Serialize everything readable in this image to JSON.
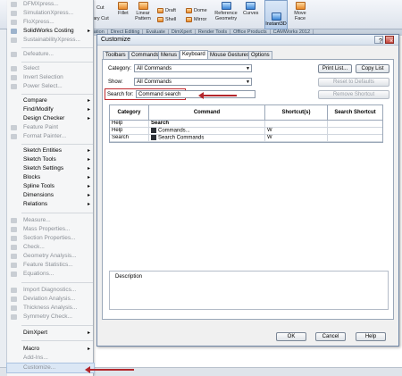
{
  "ribbon": {
    "tools": [
      {
        "label": "Fillet"
      },
      {
        "label": "Linear Pattern"
      },
      {
        "label": "Draft"
      },
      {
        "label": "Shell"
      },
      {
        "label": "Dome"
      },
      {
        "label": "Mirror"
      },
      {
        "label": "Reference Geometry"
      },
      {
        "label": "Curves"
      },
      {
        "label": "Move Face"
      }
    ],
    "instant3d": "Instant3D",
    "cut_label": "Cut",
    "ary_cut_label": "ary Cut",
    "tabs": [
      "ration",
      "Direct Editing",
      "Evaluate",
      "DimXpert",
      "Render Tools",
      "Office Products",
      "CAMWorks 2012"
    ]
  },
  "menu": {
    "items": [
      {
        "label": "DFMXpress...",
        "enabled": false
      },
      {
        "label": "SimulationXpress...",
        "enabled": false
      },
      {
        "label": "FloXpress...",
        "enabled": false
      },
      {
        "label": "SolidWorks Costing",
        "enabled": true,
        "submenu": true
      },
      {
        "label": "SustainabilityXpress...",
        "enabled": false
      },
      {
        "label": "Defeature...",
        "enabled": false
      },
      {
        "label": "Select",
        "enabled": false
      },
      {
        "label": "Invert Selection",
        "enabled": false
      },
      {
        "label": "Power Select...",
        "enabled": false
      },
      {
        "label": "Compare",
        "enabled": true,
        "submenu": true
      },
      {
        "label": "Find/Modify",
        "enabled": true,
        "submenu": true
      },
      {
        "label": "Design Checker",
        "enabled": true,
        "submenu": true
      },
      {
        "label": "Feature Paint",
        "enabled": false
      },
      {
        "label": "Format Painter...",
        "enabled": false
      },
      {
        "label": "Sketch Entities",
        "enabled": true,
        "submenu": true
      },
      {
        "label": "Sketch Tools",
        "enabled": true,
        "submenu": true
      },
      {
        "label": "Sketch Settings",
        "enabled": true,
        "submenu": true
      },
      {
        "label": "Blocks",
        "enabled": true,
        "submenu": true
      },
      {
        "label": "Spline Tools",
        "enabled": true,
        "submenu": true
      },
      {
        "label": "Dimensions",
        "enabled": true,
        "submenu": true
      },
      {
        "label": "Relations",
        "enabled": true,
        "submenu": true
      },
      {
        "label": "Measure...",
        "enabled": false
      },
      {
        "label": "Mass Properties...",
        "enabled": false
      },
      {
        "label": "Section Properties...",
        "enabled": false
      },
      {
        "label": "Check...",
        "enabled": false
      },
      {
        "label": "Geometry Analysis...",
        "enabled": false
      },
      {
        "label": "Feature Statistics...",
        "enabled": false
      },
      {
        "label": "Equations...",
        "enabled": false
      },
      {
        "label": "Import Diagnostics...",
        "enabled": false
      },
      {
        "label": "Deviation  Analysis...",
        "enabled": false
      },
      {
        "label": "Thickness Analysis...",
        "enabled": false
      },
      {
        "label": "Symmetry Check...",
        "enabled": false
      },
      {
        "label": "DimXpert",
        "enabled": true,
        "submenu": true
      },
      {
        "label": "Macro",
        "enabled": true,
        "submenu": true
      },
      {
        "label": "Add-Ins...",
        "enabled": false
      },
      {
        "label": "Customize...",
        "enabled": false
      }
    ]
  },
  "dialog": {
    "title": "Customize",
    "tabs": [
      "Toolbars",
      "Commands",
      "Menus",
      "Keyboard",
      "Mouse Gestures",
      "Options"
    ],
    "category_label": "Category:",
    "category_value": "All Commands",
    "show_label": "Show:",
    "show_value": "All Commands",
    "search_label": "Search for:",
    "search_value": "Command search",
    "print_list": "Print List...",
    "copy_list": "Copy List",
    "reset_defaults": "Reset to Defaults",
    "remove_shortcut": "Remove Shortcut",
    "columns": [
      "Category",
      "Command",
      "Shortcut(s)",
      "Search Shortcut"
    ],
    "rows": [
      {
        "category": "Help",
        "command": "Search",
        "shortcut": "",
        "search": "",
        "group": true
      },
      {
        "category": "Help",
        "command": "Commands...",
        "shortcut": "W",
        "search": ""
      },
      {
        "category": "Search",
        "command": "Search Commands",
        "shortcut": "W",
        "search": ""
      }
    ],
    "description_label": "Description",
    "ok": "OK",
    "cancel": "Cancel",
    "help": "Help",
    "help_glyph": "?",
    "close_glyph": "×"
  }
}
